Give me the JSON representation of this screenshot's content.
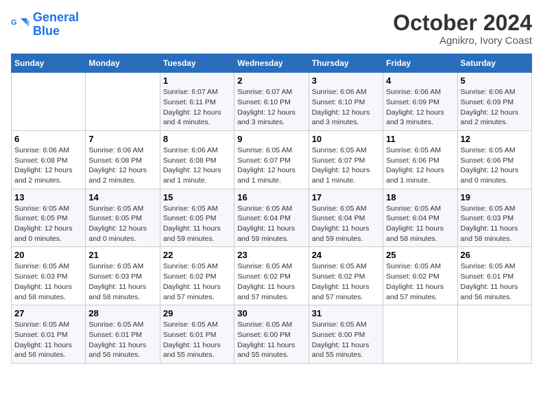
{
  "logo": {
    "text1": "General",
    "text2": "Blue"
  },
  "title": "October 2024",
  "subtitle": "Agnikro, Ivory Coast",
  "days_of_week": [
    "Sunday",
    "Monday",
    "Tuesday",
    "Wednesday",
    "Thursday",
    "Friday",
    "Saturday"
  ],
  "weeks": [
    [
      {
        "day": "",
        "info": ""
      },
      {
        "day": "",
        "info": ""
      },
      {
        "day": "1",
        "info": "Sunrise: 6:07 AM\nSunset: 6:11 PM\nDaylight: 12 hours\nand 4 minutes."
      },
      {
        "day": "2",
        "info": "Sunrise: 6:07 AM\nSunset: 6:10 PM\nDaylight: 12 hours\nand 3 minutes."
      },
      {
        "day": "3",
        "info": "Sunrise: 6:06 AM\nSunset: 6:10 PM\nDaylight: 12 hours\nand 3 minutes."
      },
      {
        "day": "4",
        "info": "Sunrise: 6:06 AM\nSunset: 6:09 PM\nDaylight: 12 hours\nand 3 minutes."
      },
      {
        "day": "5",
        "info": "Sunrise: 6:06 AM\nSunset: 6:09 PM\nDaylight: 12 hours\nand 2 minutes."
      }
    ],
    [
      {
        "day": "6",
        "info": "Sunrise: 6:06 AM\nSunset: 6:08 PM\nDaylight: 12 hours\nand 2 minutes."
      },
      {
        "day": "7",
        "info": "Sunrise: 6:06 AM\nSunset: 6:08 PM\nDaylight: 12 hours\nand 2 minutes."
      },
      {
        "day": "8",
        "info": "Sunrise: 6:06 AM\nSunset: 6:08 PM\nDaylight: 12 hours\nand 1 minute."
      },
      {
        "day": "9",
        "info": "Sunrise: 6:05 AM\nSunset: 6:07 PM\nDaylight: 12 hours\nand 1 minute."
      },
      {
        "day": "10",
        "info": "Sunrise: 6:05 AM\nSunset: 6:07 PM\nDaylight: 12 hours\nand 1 minute."
      },
      {
        "day": "11",
        "info": "Sunrise: 6:05 AM\nSunset: 6:06 PM\nDaylight: 12 hours\nand 1 minute."
      },
      {
        "day": "12",
        "info": "Sunrise: 6:05 AM\nSunset: 6:06 PM\nDaylight: 12 hours\nand 0 minutes."
      }
    ],
    [
      {
        "day": "13",
        "info": "Sunrise: 6:05 AM\nSunset: 6:05 PM\nDaylight: 12 hours\nand 0 minutes."
      },
      {
        "day": "14",
        "info": "Sunrise: 6:05 AM\nSunset: 6:05 PM\nDaylight: 12 hours\nand 0 minutes."
      },
      {
        "day": "15",
        "info": "Sunrise: 6:05 AM\nSunset: 6:05 PM\nDaylight: 11 hours\nand 59 minutes."
      },
      {
        "day": "16",
        "info": "Sunrise: 6:05 AM\nSunset: 6:04 PM\nDaylight: 11 hours\nand 59 minutes."
      },
      {
        "day": "17",
        "info": "Sunrise: 6:05 AM\nSunset: 6:04 PM\nDaylight: 11 hours\nand 59 minutes."
      },
      {
        "day": "18",
        "info": "Sunrise: 6:05 AM\nSunset: 6:04 PM\nDaylight: 11 hours\nand 58 minutes."
      },
      {
        "day": "19",
        "info": "Sunrise: 6:05 AM\nSunset: 6:03 PM\nDaylight: 11 hours\nand 58 minutes."
      }
    ],
    [
      {
        "day": "20",
        "info": "Sunrise: 6:05 AM\nSunset: 6:03 PM\nDaylight: 11 hours\nand 58 minutes."
      },
      {
        "day": "21",
        "info": "Sunrise: 6:05 AM\nSunset: 6:03 PM\nDaylight: 11 hours\nand 58 minutes."
      },
      {
        "day": "22",
        "info": "Sunrise: 6:05 AM\nSunset: 6:02 PM\nDaylight: 11 hours\nand 57 minutes."
      },
      {
        "day": "23",
        "info": "Sunrise: 6:05 AM\nSunset: 6:02 PM\nDaylight: 11 hours\nand 57 minutes."
      },
      {
        "day": "24",
        "info": "Sunrise: 6:05 AM\nSunset: 6:02 PM\nDaylight: 11 hours\nand 57 minutes."
      },
      {
        "day": "25",
        "info": "Sunrise: 6:05 AM\nSunset: 6:02 PM\nDaylight: 11 hours\nand 57 minutes."
      },
      {
        "day": "26",
        "info": "Sunrise: 6:05 AM\nSunset: 6:01 PM\nDaylight: 11 hours\nand 56 minutes."
      }
    ],
    [
      {
        "day": "27",
        "info": "Sunrise: 6:05 AM\nSunset: 6:01 PM\nDaylight: 11 hours\nand 56 minutes."
      },
      {
        "day": "28",
        "info": "Sunrise: 6:05 AM\nSunset: 6:01 PM\nDaylight: 11 hours\nand 56 minutes."
      },
      {
        "day": "29",
        "info": "Sunrise: 6:05 AM\nSunset: 6:01 PM\nDaylight: 11 hours\nand 55 minutes."
      },
      {
        "day": "30",
        "info": "Sunrise: 6:05 AM\nSunset: 6:00 PM\nDaylight: 11 hours\nand 55 minutes."
      },
      {
        "day": "31",
        "info": "Sunrise: 6:05 AM\nSunset: 6:00 PM\nDaylight: 11 hours\nand 55 minutes."
      },
      {
        "day": "",
        "info": ""
      },
      {
        "day": "",
        "info": ""
      }
    ]
  ]
}
